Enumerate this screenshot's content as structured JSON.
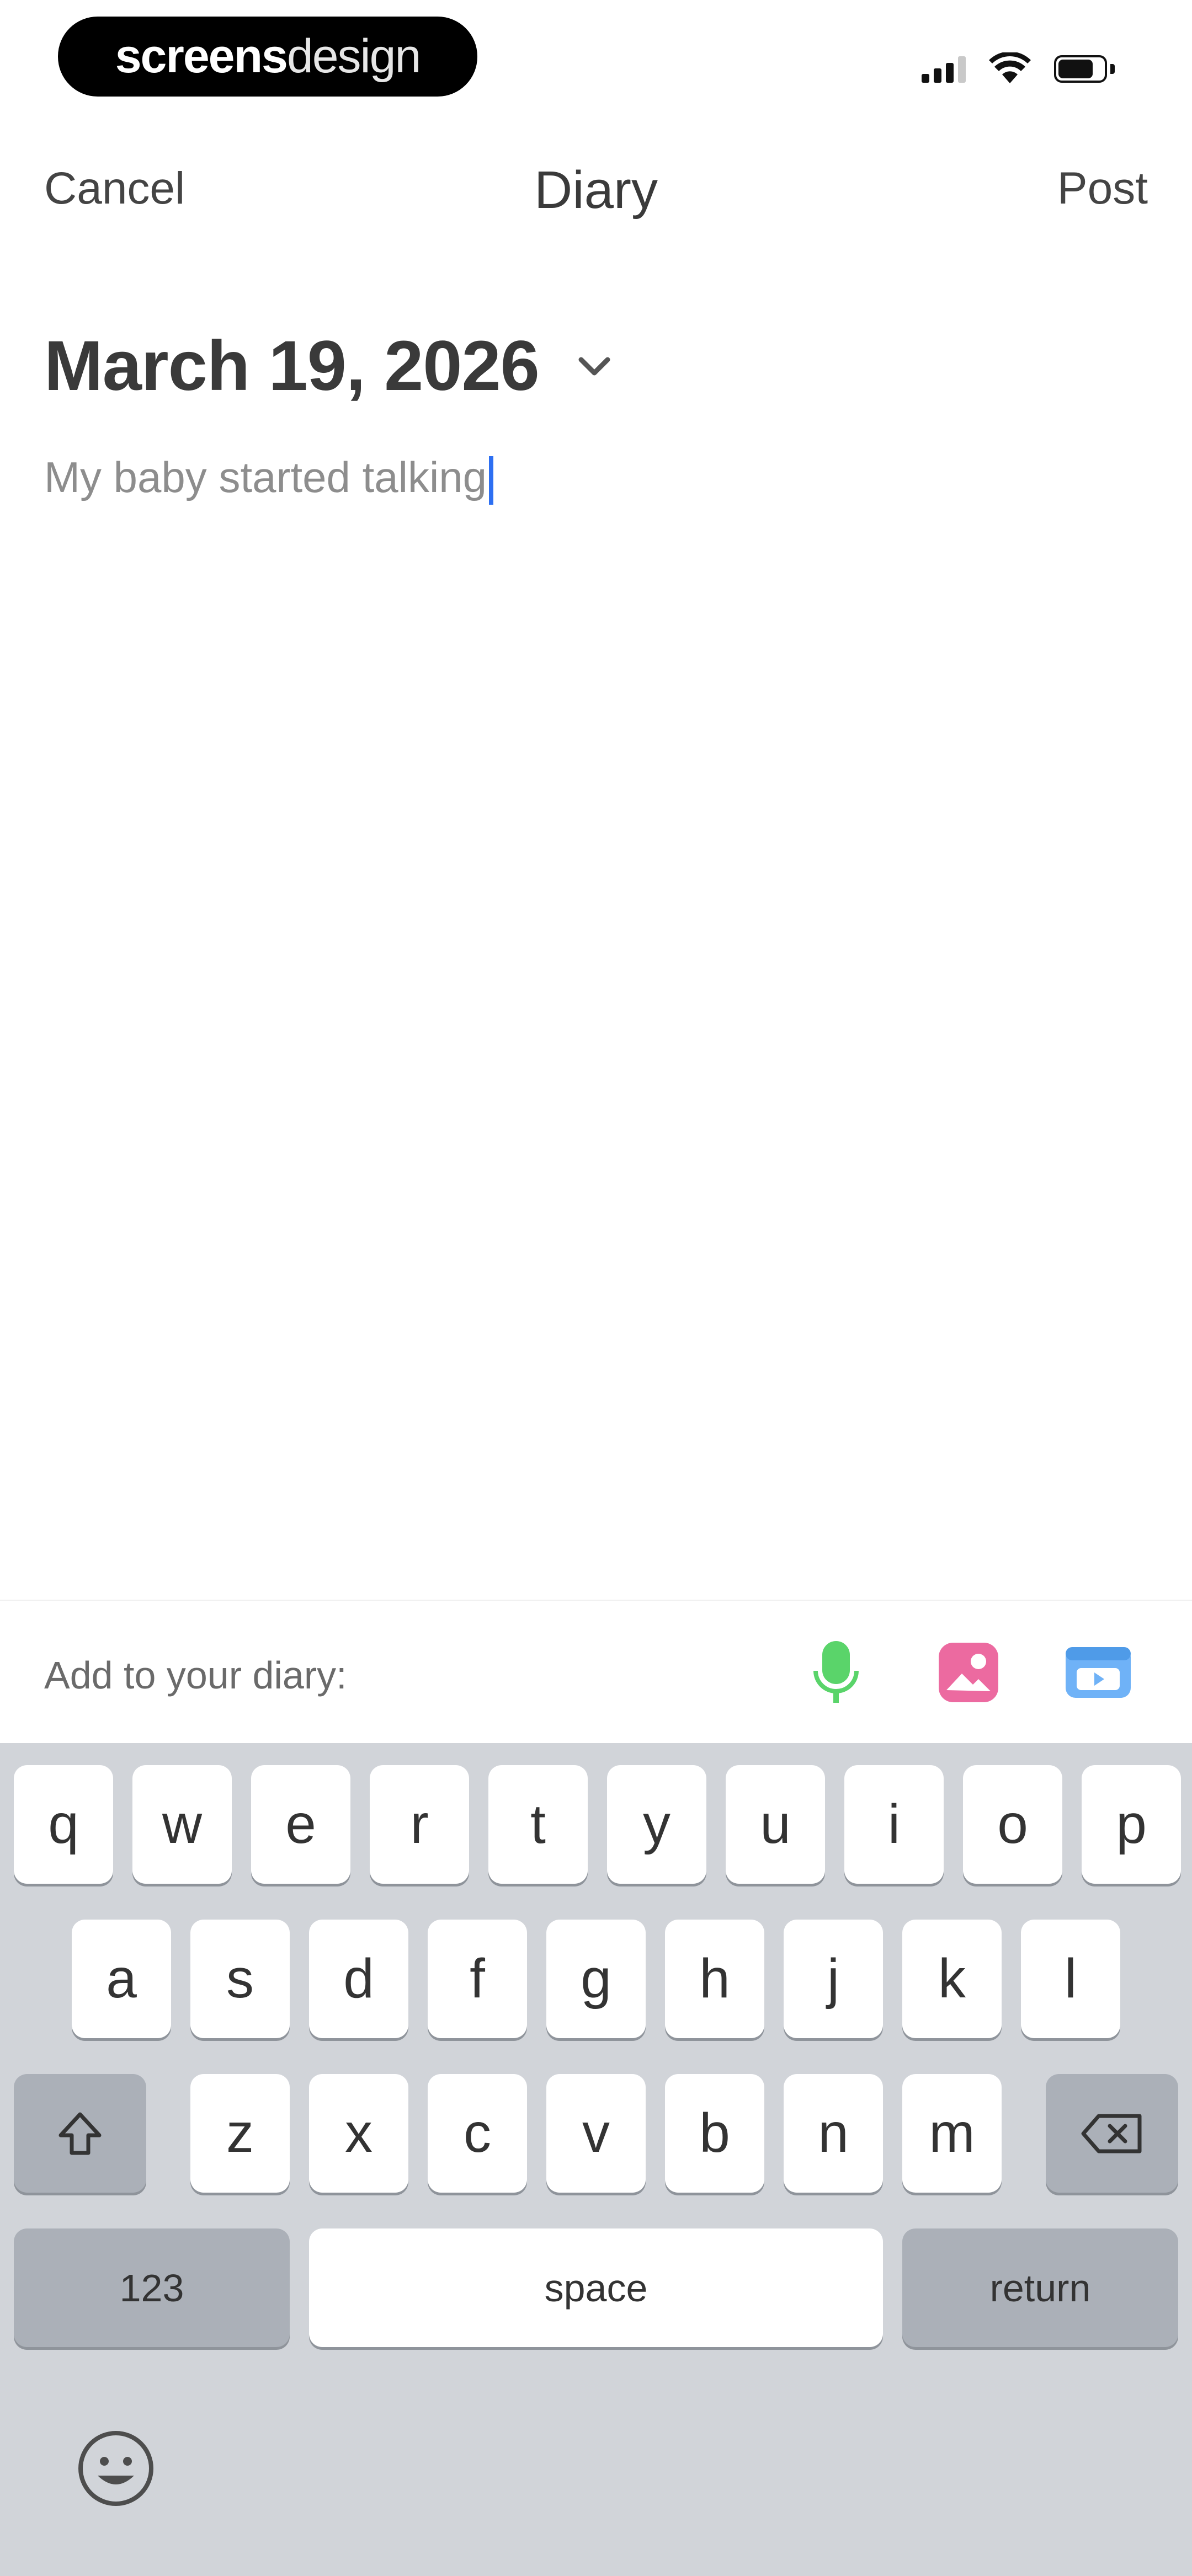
{
  "status_bar": {
    "brand_bold": "screens",
    "brand_light": "design",
    "icons": [
      "cellular-signal-icon",
      "wifi-icon",
      "battery-icon"
    ]
  },
  "nav": {
    "cancel_label": "Cancel",
    "title": "Diary",
    "post_label": "Post"
  },
  "entry": {
    "date": "March 19, 2026",
    "text": "My baby started talking"
  },
  "diary_bar": {
    "label": "Add to your diary:",
    "actions": [
      {
        "icon": "microphone-icon",
        "color": "#4cd964"
      },
      {
        "icon": "photo-icon",
        "color": "#e8609a"
      },
      {
        "icon": "video-icon",
        "color": "#5aa6f5"
      }
    ]
  },
  "keyboard": {
    "row1": [
      "q",
      "w",
      "e",
      "r",
      "t",
      "y",
      "u",
      "i",
      "o",
      "p"
    ],
    "row2": [
      "a",
      "s",
      "d",
      "f",
      "g",
      "h",
      "j",
      "k",
      "l"
    ],
    "row3": [
      "z",
      "x",
      "c",
      "v",
      "b",
      "n",
      "m"
    ],
    "numbers_label": "123",
    "space_label": "space",
    "return_label": "return"
  }
}
